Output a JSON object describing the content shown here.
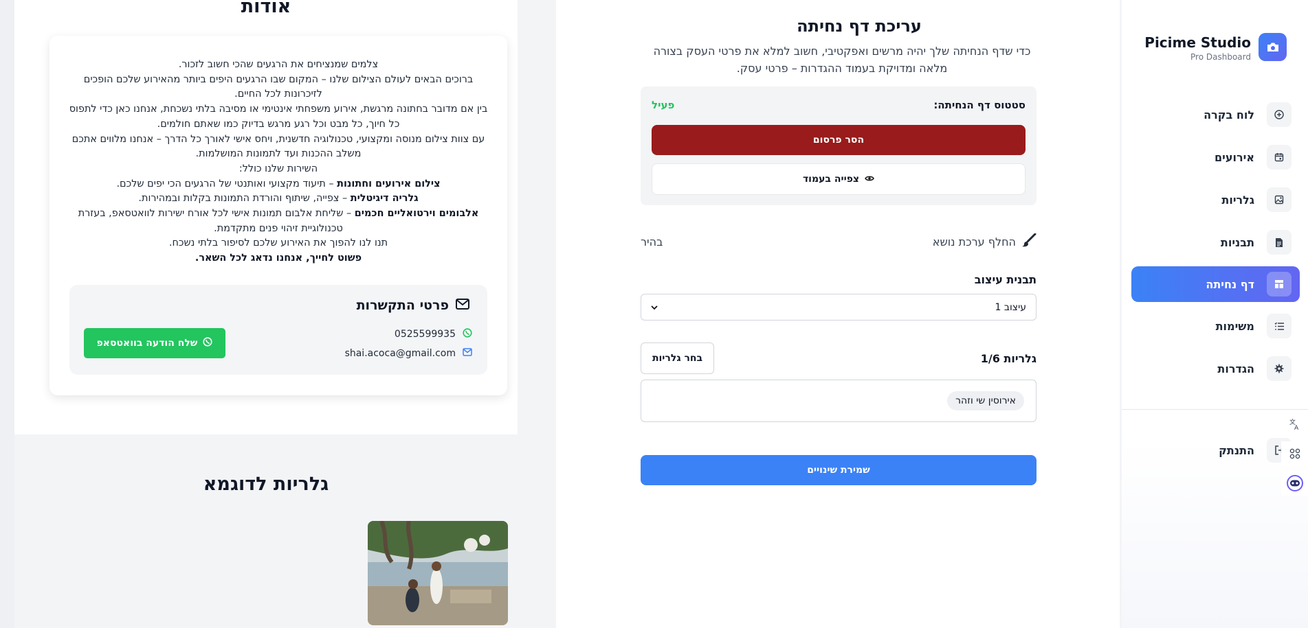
{
  "preview": {
    "about_title": "אודות",
    "about_lines": [
      {
        "bold": "",
        "text": "צלמים שמנציחים את הרגעים שהכי חשוב לזכור."
      },
      {
        "bold": "",
        "text": "ברוכים הבאים לעולם הצילום שלנו – המקום שבו הרגעים היפים ביותר מהאירוע שלכם הופכים לזיכרונות לכל החיים."
      },
      {
        "bold": "",
        "text": "בין אם מדובר בחתונה מרגשת, אירוע משפחתי אינטימי או מסיבה בלתי נשכחת, אנחנו כאן כדי לתפוס כל חיוך, כל מבט וכל רגע מרגש בדיוק כמו שאתם חולמים."
      },
      {
        "bold": "",
        "text": "עם צוות צילום מנוסה ומקצועי, טכנולוגיה חדשנית, ויחס אישי לאורך כל הדרך – אנחנו מלווים אתכם משלב ההכנות ועד לתמונות המושלמות."
      },
      {
        "bold": "",
        "text": "השירות שלנו כולל:"
      },
      {
        "bold": "צילום אירועים וחתונות",
        "text": " – תיעוד מקצועי ואותנטי של הרגעים הכי יפים שלכם."
      },
      {
        "bold": "גלריה דיגיטלית",
        "text": " – צפייה, שיתוף והורדת התמונות בקלות ובמהירות."
      },
      {
        "bold": "אלבומים וירטואליים חכמים",
        "text": " – שליחת אלבום תמונות אישי לכל אורח ישירות לוואטסאפ, בעזרת טכנולוגיית זיהוי פנים מתקדמת."
      },
      {
        "bold": "",
        "text": "תנו לנו להפוך את האירוע שלכם לסיפור בלתי נשכח."
      },
      {
        "bold": "פשוט לחייך, אנחנו נדאג לכל השאר.",
        "text": ""
      }
    ],
    "contact": {
      "title": "פרטי התקשרות",
      "phone": "0525599935",
      "email": "shai.acoca@gmail.com",
      "whatsapp_button": "שלח הודעה בוואטסאפ"
    },
    "gallery_title": "גלריות לדוגמא"
  },
  "editor": {
    "title": "עריכת דף נחיתה",
    "subtitle": "כדי שדף הנחיתה שלך יהיה מרשים ואפקטיבי, חשוב למלא את פרטי העסק בצורה מלאה ומדויקת בעמוד ההגדרות – פרטי עסק.",
    "status_label": "סטטוס דף הנחיתה:",
    "status_value": "פעיל",
    "unpublish_button": "הסר פרסום",
    "view_button": "צפייה בעמוד",
    "theme_toggle": "החלף ערכת נושא",
    "theme_mode": "בהיר",
    "template_label": "תבנית עיצוב",
    "template_value": "עיצוב 1",
    "galleries_label": "גלריות 1/6",
    "choose_galleries": "בחר גלריות",
    "selected_gallery": "אירוסין שי וזהר",
    "save_button": "שמירת שינויים"
  },
  "sidebar": {
    "brand_name": "Picime Studio",
    "brand_sub": "Pro Dashboard",
    "items": [
      {
        "label": "לוח בקרה",
        "icon": "plus-circle-icon",
        "active": false
      },
      {
        "label": "אירועים",
        "icon": "calendar-icon",
        "active": false
      },
      {
        "label": "גלריות",
        "icon": "image-icon",
        "active": false
      },
      {
        "label": "תבניות",
        "icon": "document-icon",
        "active": false
      },
      {
        "label": "דף נחיתה",
        "icon": "layout-icon",
        "active": true
      },
      {
        "label": "משימות",
        "icon": "list-icon",
        "active": false
      },
      {
        "label": "הגדרות",
        "icon": "gear-icon",
        "active": false
      }
    ],
    "logout": "התנתק"
  },
  "colors": {
    "accent": "#3b82f6",
    "danger": "#991b1b",
    "success": "#22c55e"
  }
}
